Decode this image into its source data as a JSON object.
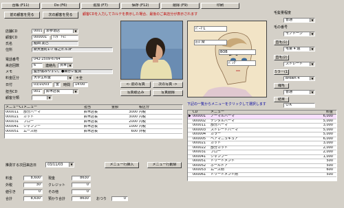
{
  "toolbar": {
    "buttons": [
      "台帳 (F11)",
      "Do (F6)",
      "追加 (F7)",
      "保存 (F12)",
      "削除 (F9)",
      "印刷"
    ]
  },
  "nav": {
    "prev_label": "前の顧客を見る",
    "next_label": "次の顧客を見る",
    "message": "顧客CDを入力してカルテを表示した場合、最後のご来店分が表示されます"
  },
  "customer": {
    "store_label": "店舗CD",
    "store_code": "0001",
    "store_name": "表参道店",
    "cust_cd_label": "顧客CD",
    "cust_cd": "000001",
    "cust_kana": "ﾃﾝﾀﾞ ﾄﾓﾐ",
    "name_label": "氏名",
    "name": "點田 友己",
    "address_label": "住所",
    "address": "新大宮町1-7 塚之ビル3F",
    "phone_label": "電話番号",
    "phone": "042-2509-6764",
    "visits_label": "来店回数",
    "visits": "6",
    "contact_label": "連絡先",
    "mobile_label": "携帯",
    "memo_label": "メモ",
    "memo": "髪が傷みやすい。●細かい髪質",
    "fee_label": "料金区分",
    "fee_value": "大学生料金",
    "note_label": "＊全",
    "date_label": "日付",
    "date": "03/10/03",
    "weekday": "金",
    "time_label": "時間",
    "time": "14:00",
    "staff_label": "担当CD",
    "staff_code": "001",
    "staff_name": "鈴木店長",
    "category_label": "顧客分類",
    "category_value": ""
  },
  "photo_buttons": {
    "prev": "<- 前の写真",
    "next": "次の写真 ->",
    "load": "写真取込み",
    "delete": "写真削除"
  },
  "right_panel": {
    "hair_volume_label": "毛髪量程度",
    "hair_volume_value": "普通",
    "hair_color_label": "毛の番号",
    "hair_color_value": "モノトーン",
    "a_label": "直毛(1)",
    "a_value": "毛量 4 過",
    "b_label": "直毛(2)",
    "b_value": "ストレート",
    "c_label": "カラー(1)",
    "c_value": "Brown 4",
    "d_label": "縮毛",
    "d_value": "普通",
    "e_label": "結果",
    "e_value": "ＯＫ"
  },
  "sketch": {
    "labels": [
      "ﾊﾟｰﾏ L",
      "ｶｯﾄ M",
      "BOB",
      "ﾊﾞﾝｸﾞ"
    ]
  },
  "menu_table": {
    "headers": [
      "メニューCD",
      "メニュー",
      "担当",
      "金額",
      "税区分"
    ],
    "rows": [
      [
        "000011",
        "部分パーマ",
        "鈴木店長",
        "3000",
        "内税"
      ],
      [
        "000021",
        "カット",
        "鈴木店長",
        "3000",
        "内税"
      ],
      [
        "000031",
        "ブロー",
        "鈴木店長",
        "2000",
        "内税"
      ],
      [
        "000041",
        "シャンプー",
        "鈴木店長",
        "1000",
        "内税"
      ],
      [
        "000051",
        "ムース剤",
        "鈴木店長",
        "600",
        "外税"
      ]
    ],
    "insert_button": "メニュー行挿入",
    "delete_button": "メニュー行削除"
  },
  "next_visit": {
    "label": "推測する次回来店日",
    "value": "03/11/03"
  },
  "totals": {
    "fee_label": "料金",
    "fee": "8,600",
    "outer_tax_label": "外税",
    "outer_tax": "30",
    "subtotal_label": "値引き",
    "subtotal": "0",
    "total_label": "合計",
    "total": "8,630",
    "cash_label": "現金",
    "cash": "8630",
    "credit_label": "クレジット",
    "credit": "0",
    "other_label": "その他",
    "other": "0",
    "paid_label": "預かり合計",
    "paid": "8630",
    "change_label": "おつり",
    "change": "0"
  },
  "menu_list": {
    "instruction": "下記の一覧からメニューをクリックして選択します",
    "headers": [
      "CD",
      "メニュー",
      "料金"
    ],
    "rows": [
      [
        "000001",
        "ノーマルパーマ",
        "6,000"
      ],
      [
        "000002",
        "デジタルパーマ",
        "5,000"
      ],
      [
        "000011",
        "部分パーマ",
        "3,000"
      ],
      [
        "000003",
        "ストレートパーマ",
        "5,000"
      ],
      [
        "000004",
        "カラー",
        "5,000"
      ],
      [
        "000005",
        "ヘアマニュキュア",
        "6,000"
      ],
      [
        "000021",
        "カット",
        "3,000"
      ],
      [
        "000022",
        "部分カット",
        "2,000"
      ],
      [
        "000031",
        "ブロー",
        "2,000"
      ],
      [
        "000041",
        "シャンプー",
        "1,000"
      ],
      [
        "000051",
        "トリートメント",
        "500"
      ],
      [
        "000052",
        "ホールドア",
        "500"
      ],
      [
        "000053",
        "ムース剤",
        "600"
      ],
      [
        "000061",
        "トリートメント剤",
        "500"
      ]
    ]
  },
  "colors": {
    "bg": "#d4d0c8",
    "photo_bg": "#5a7fa8",
    "sketch_bg": "#f0e0c0",
    "list_highlight": "#f0d0ff"
  }
}
